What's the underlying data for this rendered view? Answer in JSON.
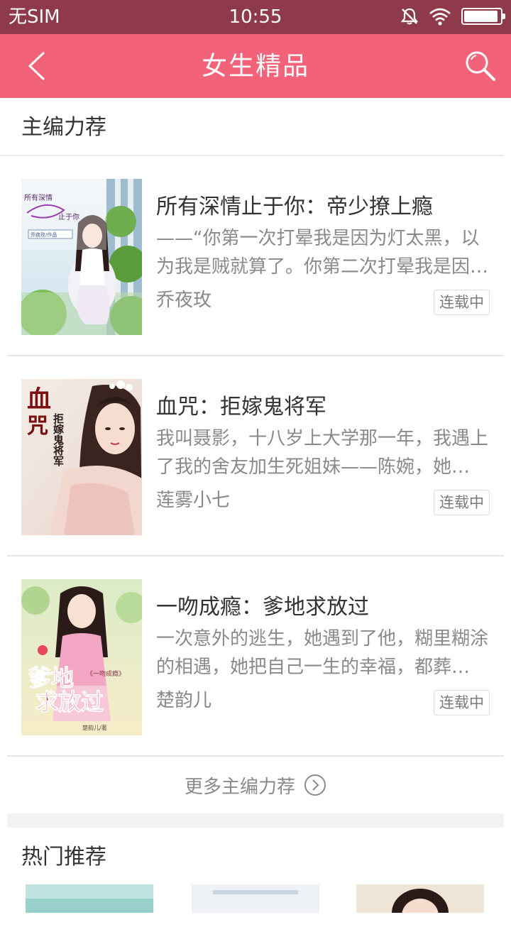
{
  "status_bar": {
    "carrier": "无SIM",
    "time": "10:55",
    "battery_percent": 95
  },
  "nav": {
    "title": "女生精品",
    "back_icon": "chevron-left-icon",
    "search_icon": "search-icon"
  },
  "editor_picks": {
    "header": "主编力荐",
    "books": [
      {
        "title": "所有深情止于你：帝少撩上瘾",
        "desc": "——“你第一次打晕我是因为灯太黑，以为我是贼就算了。你第二次打晕我是因为……",
        "author": "乔夜玫",
        "status": "连载中",
        "cover_text": [
          "所有深情",
          "止于你",
          "乔夜玫/作品"
        ]
      },
      {
        "title": "血咒：拒嫁鬼将军",
        "desc": "我叫聂影，十八岁上大学那一年，我遇上了我的舍友加生死姐妹——陈婉，她把……",
        "author": "莲雾小七",
        "status": "连载中",
        "cover_text": [
          "血",
          "咒",
          "拒嫁鬼将军"
        ]
      },
      {
        "title": "一吻成瘾：爹地求放过",
        "desc": "一次意外的逃生，她遇到了他，糊里糊涂的相遇，她把自己一生的幸福，都葬送……",
        "author": "楚韵儿",
        "status": "连载中",
        "cover_text": [
          "爹地",
          "求放过",
          "《一吻成瘾》",
          "楚韵儿/著"
        ]
      }
    ],
    "more_label": "更多主编力荐",
    "more_icon": "chevron-right-circle-icon"
  },
  "hot": {
    "header": "热门推荐"
  },
  "colors": {
    "status_bar": "#8e3a4a",
    "nav_bar": "#f2637a"
  }
}
